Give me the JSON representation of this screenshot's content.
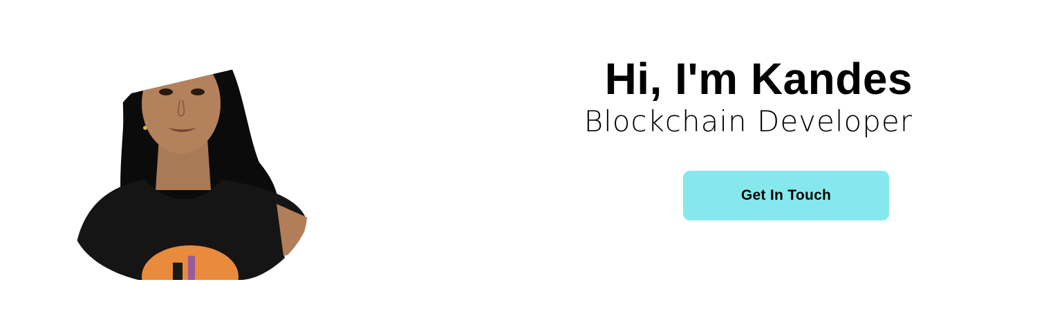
{
  "hero": {
    "greeting": "Hi, I'm Kandes",
    "role": "Blockchain Developer",
    "cta_label": "Get In Touch"
  },
  "colors": {
    "cta_background": "#86e8ec",
    "text": "#000000",
    "background": "#ffffff"
  }
}
